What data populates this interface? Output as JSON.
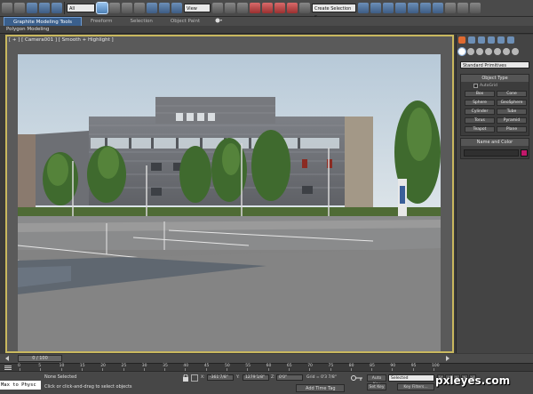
{
  "toolbar": {
    "filter_dropdown": "All",
    "ref_coord_dropdown": "View",
    "named_selection_dropdown": "Create Selection S..."
  },
  "ribbon": {
    "tabs": [
      "Graphite Modeling Tools",
      "Freeform",
      "Selection",
      "Object Paint"
    ],
    "panel_label": "Polygon Modeling"
  },
  "viewport": {
    "label": "[ + ] [ Camera001 ] [ Smooth + Highlight ]"
  },
  "command_panel": {
    "primitive_dropdown": "Standard Primitives",
    "object_type": {
      "title": "Object Type",
      "autogrid_label": "AutoGrid",
      "buttons": [
        "Box",
        "Cone",
        "Sphere",
        "GeoSphere",
        "Cylinder",
        "Tube",
        "Torus",
        "Pyramid",
        "Teapot",
        "Plane"
      ]
    },
    "name_color": {
      "title": "Name and Color",
      "swatch_color": "#c2186b"
    }
  },
  "timeline": {
    "slider_label": "0 / 100",
    "ticks": [
      "0",
      "5",
      "10",
      "15",
      "20",
      "25",
      "30",
      "35",
      "40",
      "45",
      "50",
      "55",
      "60",
      "65",
      "70",
      "75",
      "80",
      "85",
      "90",
      "95",
      "100"
    ]
  },
  "status": {
    "maxscript_text": "Max to Physc",
    "selection_info": "None Selected",
    "prompt": "Click or click-and-drag to select objects",
    "x_label": "X:",
    "x_value": "-361'7/8\"",
    "y_label": "Y:",
    "y_value": "1279'1/8\"",
    "z_label": "Z:",
    "z_value": "0'0\"",
    "grid": "Grid = 0'3 7/8\"",
    "add_time_tag": "Add Time Tag",
    "auto_key": "Auto Key",
    "set_key": "Set Key",
    "selected_dropdown": "Selected",
    "key_filters": "Key Filters..."
  },
  "watermark": "pxleyes.com"
}
